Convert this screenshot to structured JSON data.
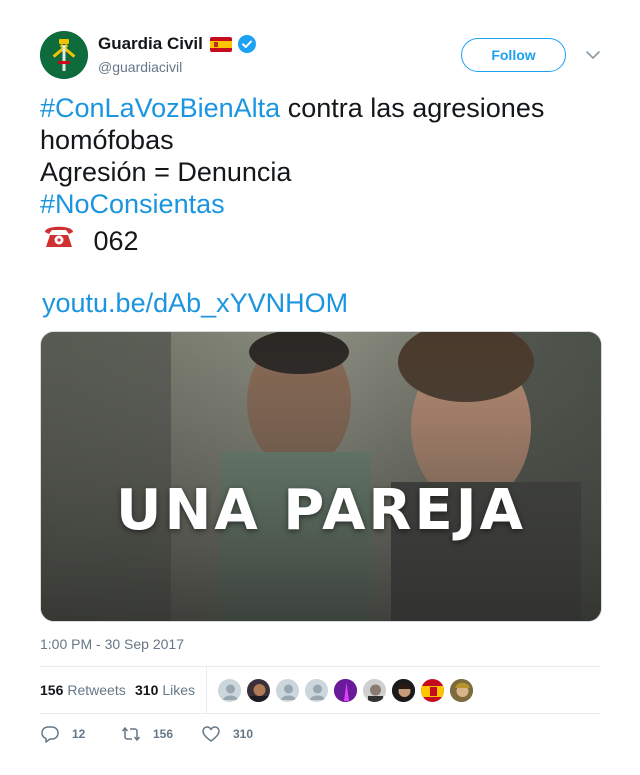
{
  "author": {
    "display_name": "Guardia Civil",
    "handle": "@guardiacivil",
    "verified": true,
    "flag_icon": "spain-flag-icon",
    "avatar_icon": "guardia-civil-emblem-icon"
  },
  "follow_button": {
    "label": "Follow"
  },
  "tweet": {
    "hashtag_1": "#ConLaVozBienAlta",
    "line_1_rest": " contra las agresiones",
    "line_2": "homófobas",
    "line_3": "Agresión = Denuncia",
    "hashtag_2": "#NoConsientas",
    "phone_icon": "telephone-emoji",
    "phone_number": "062",
    "link": "youtu.be/dAb_xYVNHOM"
  },
  "media": {
    "caption": "UNA PAREJA"
  },
  "timestamp": "1:00 PM - 30 Sep 2017",
  "stats": {
    "retweets_count": "156",
    "retweets_label": "Retweets",
    "likes_count": "310",
    "likes_label": "Likes"
  },
  "actions": {
    "reply_count": "12",
    "retweet_count": "156",
    "like_count": "310"
  },
  "colors": {
    "link_blue": "#1b95e0",
    "follow_blue": "#1da1f2",
    "muted_gray": "#657786",
    "avatar_green": "#0e6b3c"
  }
}
